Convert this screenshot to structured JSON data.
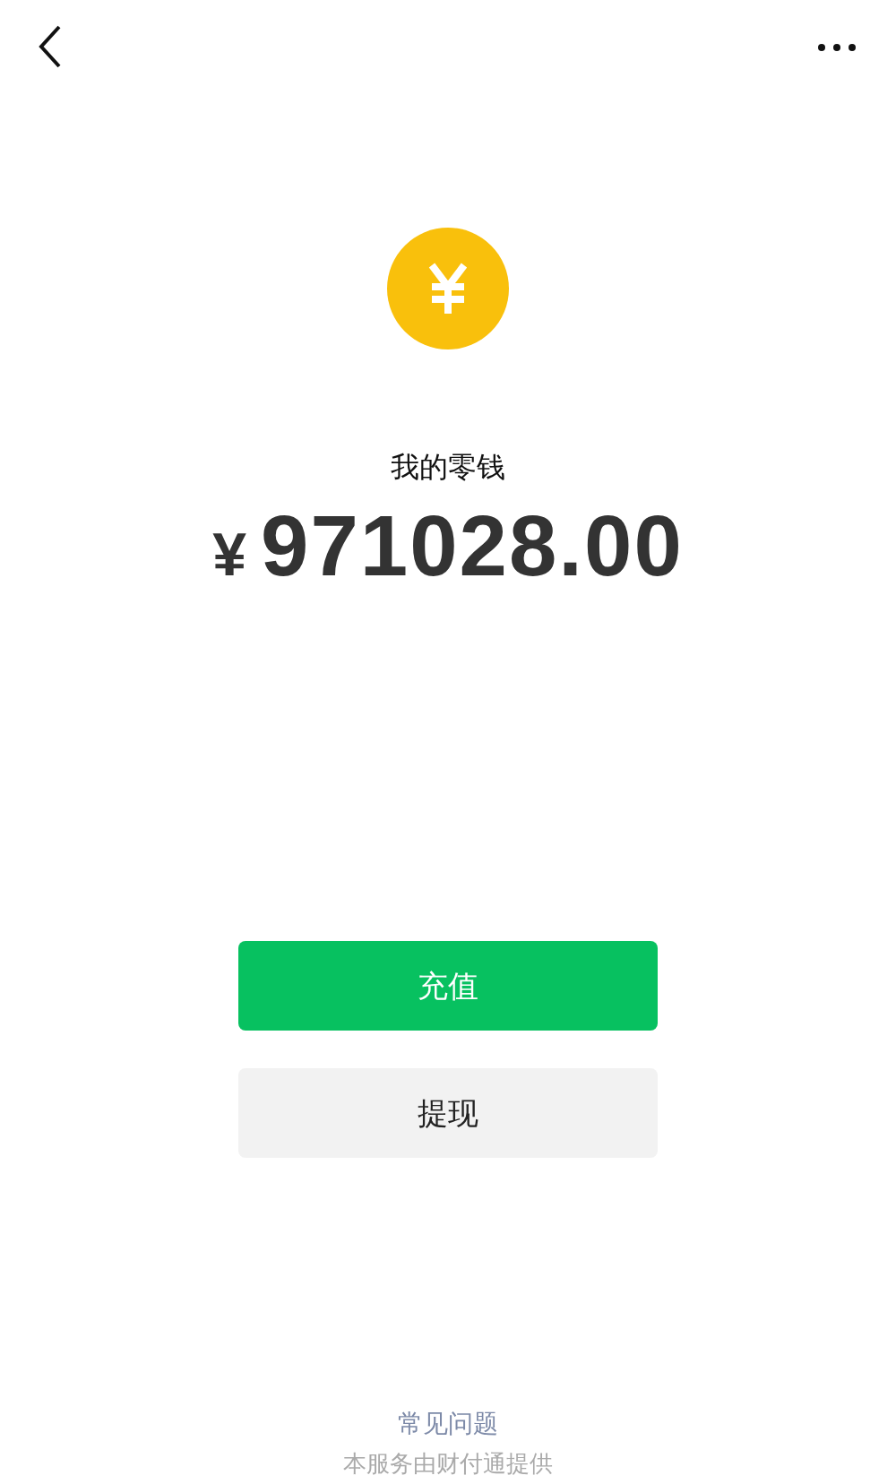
{
  "wallet": {
    "title": "我的零钱",
    "currency": "¥",
    "balance": "971028.00"
  },
  "buttons": [
    {
      "label": "充值",
      "kind": "primary"
    },
    {
      "label": "提现",
      "kind": "secondary"
    }
  ],
  "footer": {
    "link": "常见问题",
    "note": "本服务由财付通提供"
  }
}
